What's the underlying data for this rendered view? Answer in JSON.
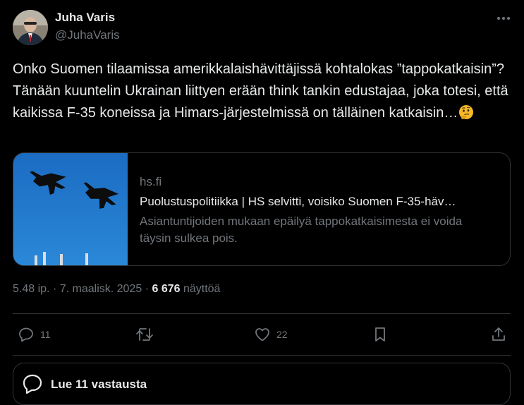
{
  "author": {
    "name": "Juha Varis",
    "handle": "@JuhaVaris"
  },
  "tweet": {
    "text": "Onko Suomen tilaamissa amerikkalaishävittäjissä kohtalokas ”tappokatkaisin”? Tänään kuuntelin Ukrainan liittyen erään think tankin edustajaa, joka totesi, että kaikissa F-35 koneissa ja Himars-järjestelmissä on tälläinen katkaisin…",
    "emoji": "thinking-face"
  },
  "card": {
    "domain": "hs.fi",
    "title": "Puolustuspolitiikka | HS selvitti, voisiko Suomen F-35-häv…",
    "description": "Asiantuntijoiden mukaan epäilyä tappokatkaisimesta ei voida täysin sulkea pois."
  },
  "meta": {
    "time": "5.48 ip.",
    "date": "7. maalisk. 2025",
    "views_count": "6 676",
    "views_label": "näyttöä"
  },
  "actions": {
    "replies": "11",
    "reposts": "",
    "likes": "22"
  },
  "replies_button": {
    "label": "Lue 11 vastausta"
  },
  "colors": {
    "background": "#000000",
    "text": "#e7e9ea",
    "muted": "#71767b",
    "border": "#2f3336"
  }
}
